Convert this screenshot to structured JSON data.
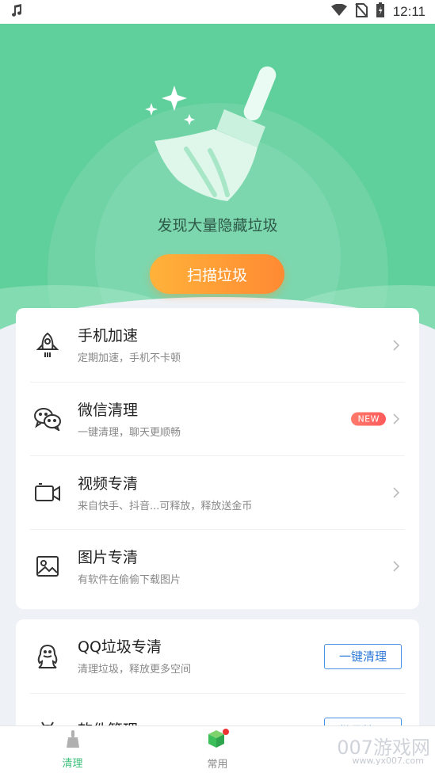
{
  "status_bar": {
    "time": "12:11",
    "icons": [
      "music-note-icon",
      "wifi-icon",
      "no-sim-icon",
      "battery-icon"
    ]
  },
  "hero": {
    "tagline": "发现大量隐藏垃圾",
    "scan_button": "扫描垃圾",
    "colors": {
      "green": "#5fcf9b",
      "button_start": "#ffb23a",
      "button_end": "#ff8a33"
    }
  },
  "card1": {
    "items": [
      {
        "title": "手机加速",
        "subtitle": "定期加速，手机不卡顿",
        "icon": "rocket-icon"
      },
      {
        "title": "微信清理",
        "subtitle": "一键清理，聊天更顺畅",
        "icon": "wechat-icon",
        "badge": "NEW"
      },
      {
        "title": "视频专清",
        "subtitle": "来自快手、抖音...可释放，释放送金币",
        "icon": "video-camera-icon"
      },
      {
        "title": "图片专清",
        "subtitle": "有软件在偷偷下载图片",
        "icon": "image-icon"
      }
    ]
  },
  "card2": {
    "items": [
      {
        "title": "QQ垃圾专清",
        "subtitle": "清理垃圾，释放更多空间",
        "icon": "qq-penguin-icon",
        "button": "一键清理"
      },
      {
        "title": "软件管理",
        "icon": "android-icon",
        "button": "批量管理"
      }
    ]
  },
  "tabbar": {
    "tabs": [
      {
        "label": "清理",
        "icon": "broom-icon",
        "active": true
      },
      {
        "label": "常用",
        "icon": "cube-icon",
        "active": false
      }
    ]
  },
  "watermark": {
    "text": "007游戏网",
    "url_text": "www.yx007.com"
  }
}
